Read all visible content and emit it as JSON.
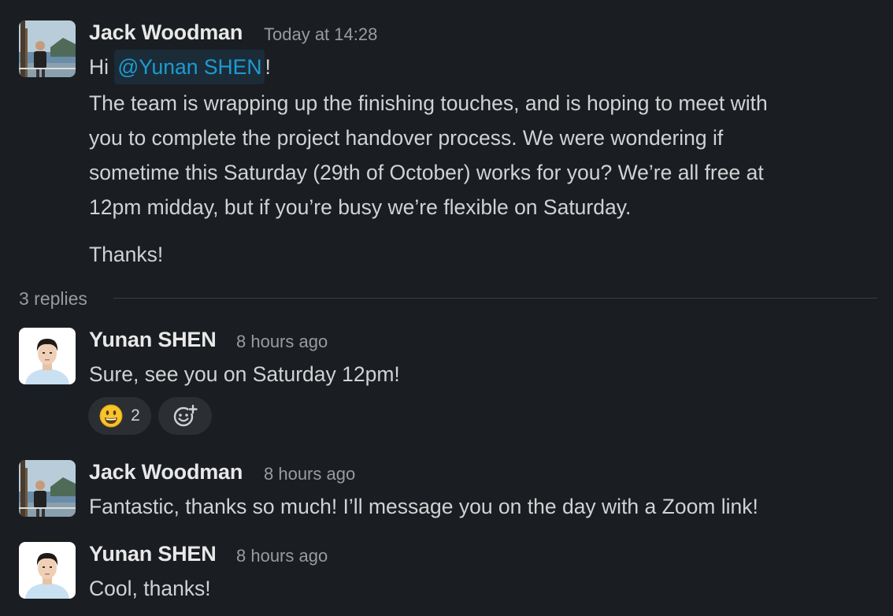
{
  "messages": [
    {
      "author": "Jack Woodman",
      "time": "Today at 14:28",
      "greeting_prefix": "Hi",
      "mention": "@Yunan SHEN",
      "greeting_suffix": "!",
      "body_lines": [
        "The team is wrapping up the finishing touches, and is hoping to meet with",
        "you to complete the project handover process. We were wondering if",
        "sometime this Saturday (29th of October) works for you? We’re all free at",
        "12pm midday, but if you’re busy we’re flexible on Saturday."
      ],
      "closing": "Thanks!"
    },
    {
      "author": "Yunan SHEN",
      "time": "8 hours ago",
      "text": "Sure, see you on Saturday 12pm!",
      "reactions": [
        {
          "emoji": "grinning-face",
          "count": "2"
        }
      ]
    },
    {
      "author": "Jack Woodman",
      "time": "8 hours ago",
      "text": "Fantastic, thanks so much! I’ll message you on the day with a Zoom link!"
    },
    {
      "author": "Yunan SHEN",
      "time": "8 hours ago",
      "text": "Cool, thanks!"
    }
  ],
  "thread": {
    "replies_label": "3 replies"
  },
  "colors": {
    "background": "#1a1d21",
    "mention_text": "#1d9bd1",
    "mention_bg": "#1b2c38",
    "reaction_bg": "#2b2e33"
  }
}
